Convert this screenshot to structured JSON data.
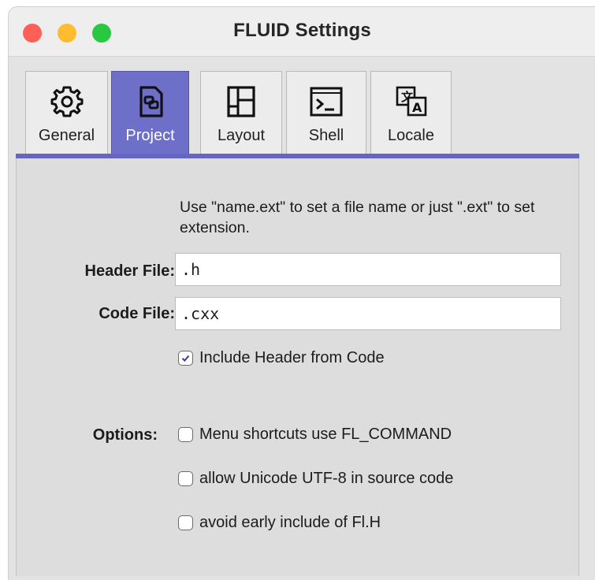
{
  "window": {
    "title": "FLUID Settings",
    "colors": {
      "close": "#fe5f57",
      "minimize": "#febc2e",
      "zoom": "#28c840",
      "tab_active": "#6d6fc9"
    }
  },
  "tabs": [
    {
      "label": "General",
      "icon": "gear-icon",
      "active": false
    },
    {
      "label": "Project",
      "icon": "project-icon",
      "active": true
    },
    {
      "label": "Layout",
      "icon": "layout-icon",
      "active": false
    },
    {
      "label": "Shell",
      "icon": "terminal-icon",
      "active": false
    },
    {
      "label": "Locale",
      "icon": "translate-icon",
      "active": false
    }
  ],
  "project": {
    "hint": "Use \"name.ext\" to set a file name or just \".ext\" to set extension.",
    "header_file": {
      "label": "Header File:",
      "value": ".h"
    },
    "code_file": {
      "label": "Code File:",
      "value": ".cxx"
    },
    "include_header": {
      "label": "Include Header from Code",
      "checked": true
    },
    "options_label": "Options:",
    "options": [
      {
        "label": "Menu shortcuts use FL_COMMAND",
        "checked": false
      },
      {
        "label": "allow Unicode UTF-8 in source code",
        "checked": false
      },
      {
        "label": "avoid early include of Fl.H",
        "checked": false
      }
    ]
  }
}
